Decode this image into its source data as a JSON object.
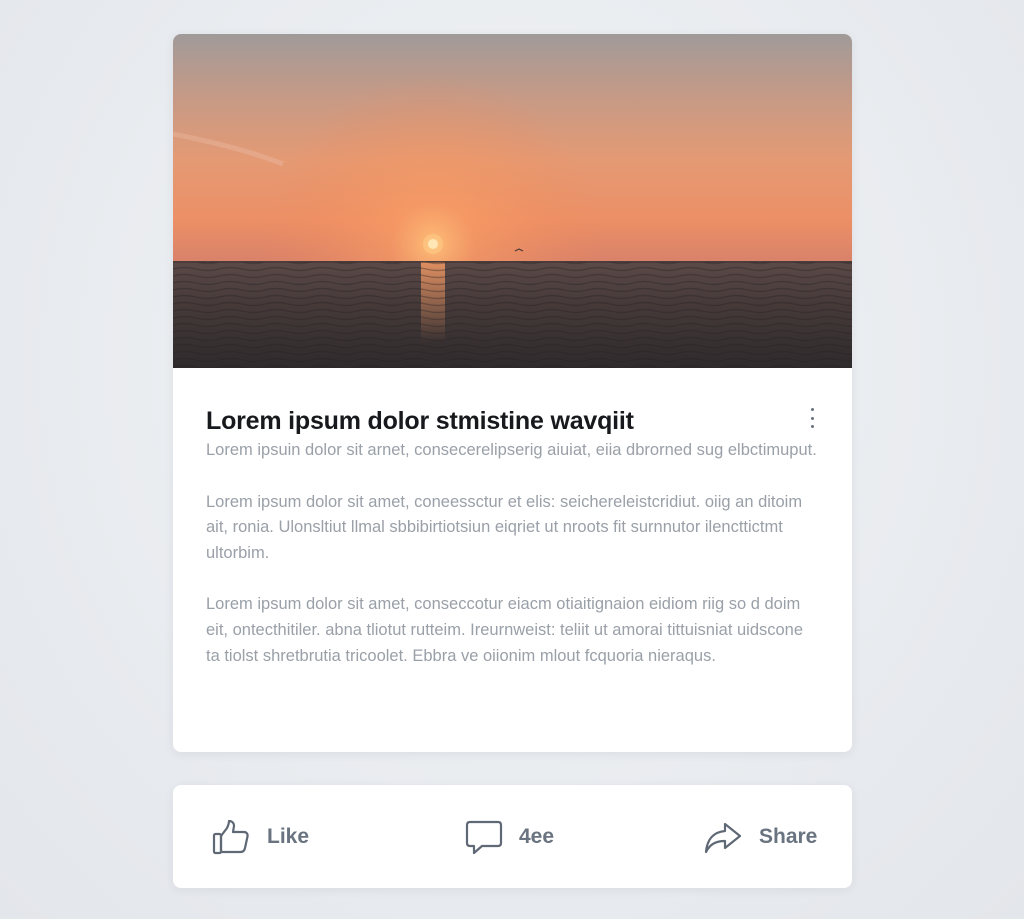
{
  "post": {
    "image": {
      "subject": "sunset-over-sea",
      "colors": {
        "sky_top": "#9a9594",
        "sky_mid": "#e8906a",
        "horizon": "#f08a5a",
        "sea": "#3a3230"
      }
    },
    "title": "Lorem ipsum dolor stmistine wavqiit",
    "paragraphs": [
      "Lorem ipsuin dolor sit arnet, consecerelipserig aiuiat, eiia dbrorned sug elbctimuput.",
      "Lorem ipsum dolor sit amet, coneessctur et elis: seichereleistcridiut. oiig an ditoim ait, ronia. Ulonsltiut llmal sbbibirtiotsiun eiqriet ut nroots fit surnnutor ilencttictmt ultorbim.",
      "Lorem ipsum dolor sit amet, conseccotur eiacm otiaitignaion eidiom riig so d doim eit, ontecthitiler. abna tliotut rutteim. Ireurnweist: teliit ut amorai tittuisniat uidscone ta tiolst shretbrutia tricoolet. Ebbra ve oiionim mlout fcquoria nieraqus."
    ],
    "menu_icon": "more-vertical-icon"
  },
  "actions": {
    "like": {
      "label": "Like",
      "icon": "thumbs-up-icon"
    },
    "comment": {
      "label": "4ee",
      "icon": "comment-icon"
    },
    "share": {
      "label": "Share",
      "icon": "share-arrow-icon"
    }
  },
  "colors": {
    "background": "#e9ecf0",
    "card": "#ffffff",
    "title": "#17191c",
    "body_text": "#9aa0a8",
    "action_text": "#6a7380"
  }
}
